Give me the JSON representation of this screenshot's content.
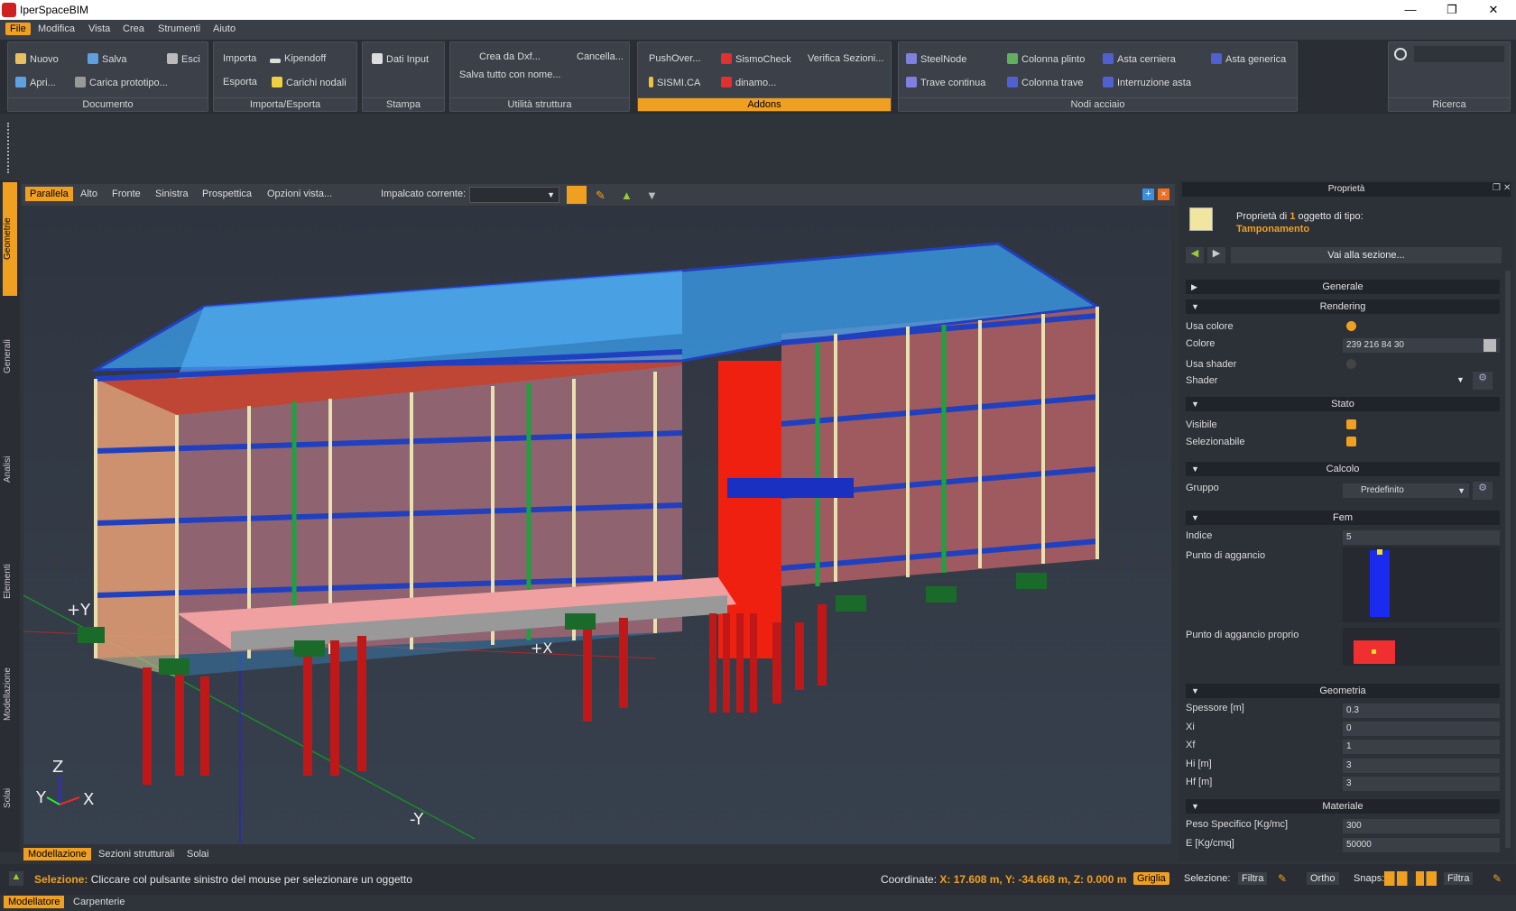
{
  "app": {
    "title": "IperSpaceBIM"
  },
  "window_controls": {
    "minimize": "—",
    "maximize": "❐",
    "close": "✕"
  },
  "menu": [
    "File",
    "Modifica",
    "Vista",
    "Crea",
    "Strumenti",
    "Aiuto"
  ],
  "ribbon": {
    "documento": {
      "label": "Documento",
      "nuovo": "Nuovo",
      "salva": "Salva",
      "esci": "Esci",
      "apri": "Apri...",
      "carica": "Carica prototipo..."
    },
    "importa": {
      "label": "Importa/Esporta",
      "importa": "Importa",
      "kipendoff": "Kipendoff",
      "esporta": "Esporta",
      "carichi": "Carichi nodali"
    },
    "stampa": {
      "label": "Stampa",
      "dati": "Dati Input"
    },
    "utilita": {
      "label": "Utilità struttura",
      "crea": "Crea da Dxf...",
      "cancella": "Cancella...",
      "salva_tutto": "Salva tutto con nome..."
    },
    "addons": {
      "label": "Addons",
      "pushover": "PushOver...",
      "sismocheck": "SismoCheck",
      "verifica": "Verifica Sezioni...",
      "sismica": "SISMI.CA",
      "dinamo": "dinamo..."
    },
    "nodi": {
      "label": "Nodi acciaio",
      "steelnode": "SteelNode",
      "colonna_plinto": "Colonna plinto",
      "asta_cerniera": "Asta cerniera",
      "asta_generica": "Asta generica",
      "trave_continua": "Trave continua",
      "colonna_trave": "Colonna trave",
      "interruzione": "Interruzione asta"
    },
    "ricerca": {
      "label": "Ricerca"
    }
  },
  "left_tabs": [
    "Geometrie",
    "Generali",
    "Analisi",
    "Elementi",
    "Modellazione",
    "Solai"
  ],
  "view_toolbar": {
    "views": [
      "Parallela",
      "Alto",
      "Fronte",
      "Sinistra",
      "Prospettica"
    ],
    "opzioni": "Opzioni vista...",
    "impalcato": "Impalcato corrente:"
  },
  "viewport": {
    "axes": {
      "plus_y": "+Y",
      "plus_x": "+X",
      "minus_y": "-Y",
      "z": "Z",
      "y": "Y",
      "x": "X"
    }
  },
  "bottom_tabs": [
    "Modellazione",
    "Sezioni strutturali",
    "Solai"
  ],
  "panel": {
    "title": "Proprietà",
    "header_line1_pre": "Proprietà di ",
    "header_count": "1",
    "header_line1_post": " oggetto di tipo:",
    "header_type": "Tamponamento",
    "goto": "Vai alla sezione...",
    "sections": {
      "generale": "Generale",
      "rendering": "Rendering",
      "stato": "Stato",
      "calcolo": "Calcolo",
      "fem": "Fem",
      "geometria": "Geometria",
      "materiale": "Materiale"
    },
    "rows": {
      "usa_colore": "Usa colore",
      "colore": "Colore",
      "colore_val": "239 216 84 30",
      "usa_shader": "Usa shader",
      "shader": "Shader",
      "visibile": "Visibile",
      "selezionabile": "Selezionabile",
      "gruppo": "Gruppo",
      "gruppo_val": "Predefinito",
      "indice": "Indice",
      "indice_val": "5",
      "punto": "Punto di aggancio",
      "punto_proprio": "Punto di aggancio proprio",
      "spessore": "Spessore [m]",
      "spessore_val": "0.3",
      "xi": "Xi",
      "xi_val": "0",
      "xf": "Xf",
      "xf_val": "1",
      "hi": "Hi [m]",
      "hi_val": "3",
      "hf": "Hf [m]",
      "hf_val": "3",
      "peso": "Peso Specifico [Kg/mc]",
      "peso_val": "300",
      "e": "E [Kg/cmq]",
      "e_val": "50000"
    }
  },
  "status": {
    "sel_label": "Selezione:",
    "sel_text": "Cliccare col pulsante sinistro del mouse per selezionare un oggetto",
    "coord_label": "Coordinate:",
    "coord_val": "X: 17.608 m, Y: -34.668 m, Z: 0.000 m",
    "griglia": "Griglia",
    "selezione": "Selezione:",
    "filtra": "Filtra",
    "ortho": "Ortho",
    "snaps": "Snaps:",
    "filtra2": "Filtra"
  },
  "app_tabs": [
    "Modellatore",
    "Carpenterie"
  ],
  "colors": {
    "accent": "#f0a020",
    "panel": "#2c3037",
    "wall": "#ef4a30"
  }
}
